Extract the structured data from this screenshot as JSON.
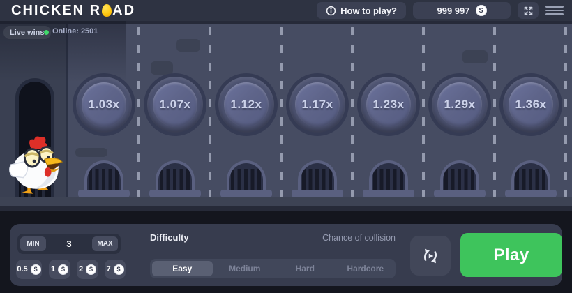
{
  "topbar": {
    "logo_left": "CHICKEN R",
    "logo_right": "AD",
    "how_to_play_label": "How to play?",
    "balance": "999 997"
  },
  "icons": {
    "coin_symbol": "$"
  },
  "game": {
    "live_wins_label": "Live wins",
    "online_label": "Online: 2501",
    "multipliers": [
      "1.03x",
      "1.07x",
      "1.12x",
      "1.17x",
      "1.23x",
      "1.29x",
      "1.36x"
    ]
  },
  "controls": {
    "min_label": "MIN",
    "max_label": "MAX",
    "bet_value": "3",
    "chips": [
      "0.5",
      "1",
      "2",
      "7"
    ],
    "difficulty_label": "Difficulty",
    "chance_of_collision_label": "Chance of collision",
    "difficulties": [
      "Easy",
      "Medium",
      "Hard",
      "Hardcore"
    ],
    "selected_difficulty": "Easy",
    "play_label": "Play"
  },
  "colors": {
    "accent_green": "#3ec45c",
    "online_dot": "#41d96b",
    "egg_yellow": "#ffca12",
    "road": "#464c62",
    "topbar_bg": "#2e3342",
    "panel_bg": "#373c4e"
  }
}
